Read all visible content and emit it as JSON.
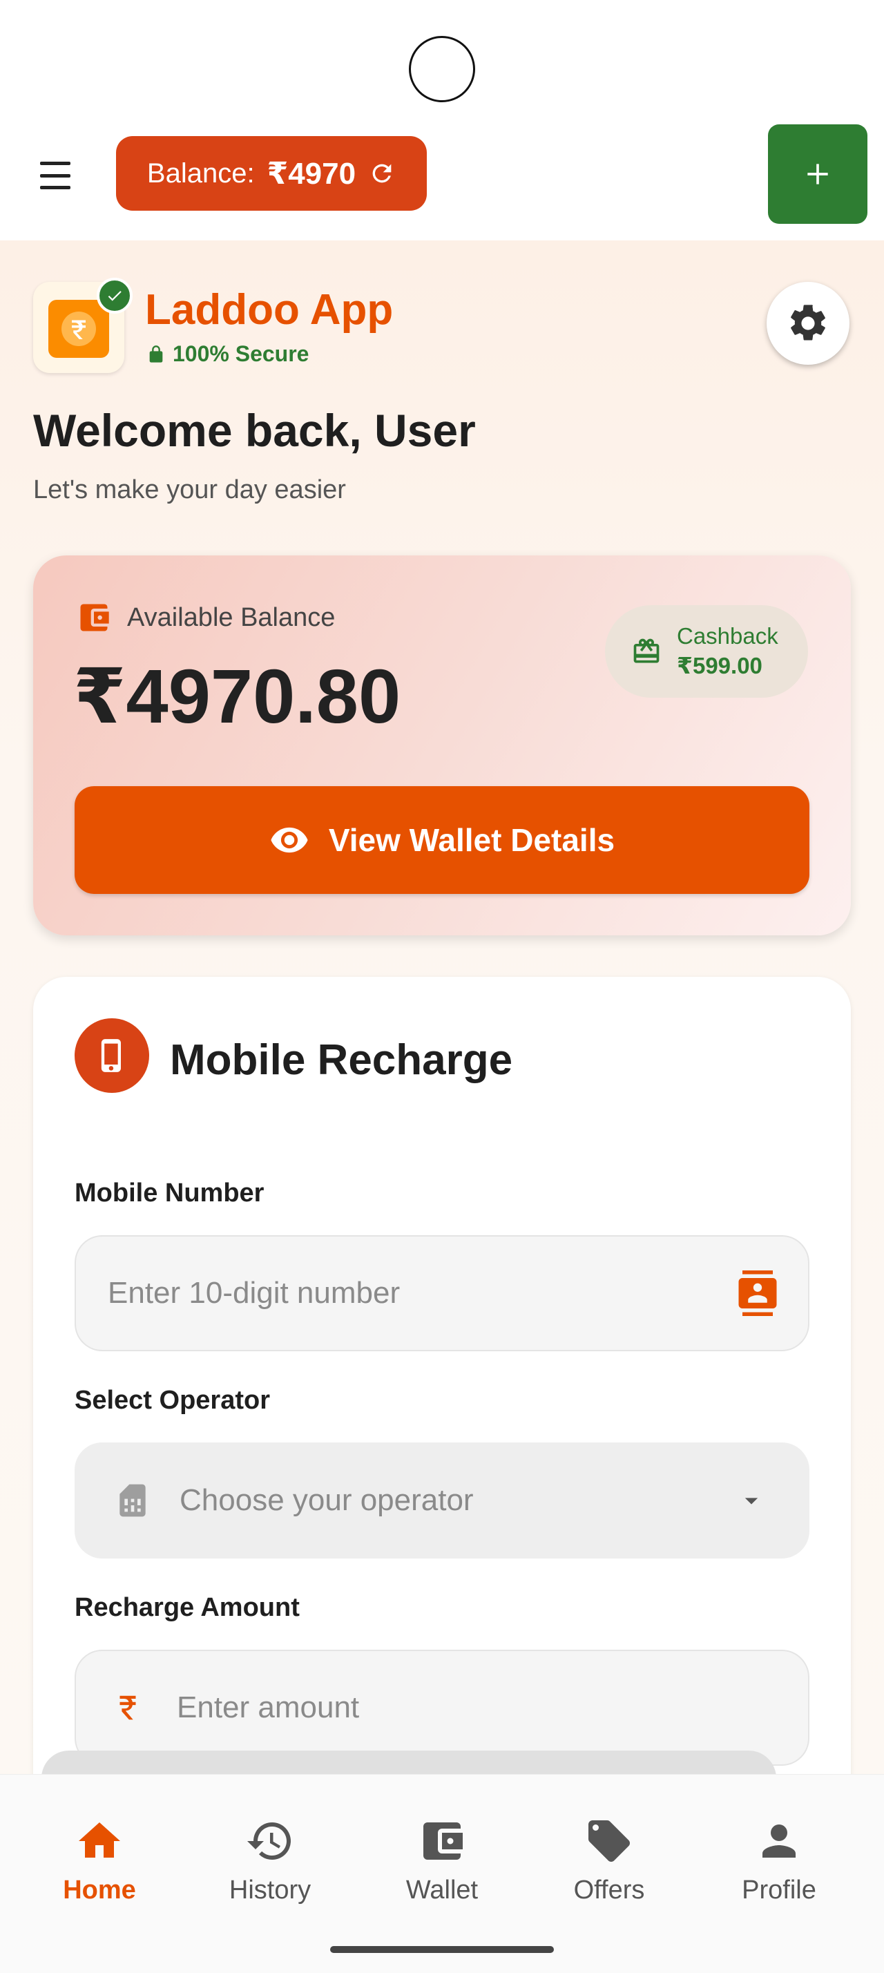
{
  "header": {
    "balance_label": "Balance:",
    "balance_amount": "₹4970"
  },
  "brand": {
    "name": "Laddoo App",
    "secure_text": "100% Secure"
  },
  "welcome": {
    "title": "Welcome back, User",
    "subtitle": "Let's make your day easier"
  },
  "wallet_card": {
    "label": "Available Balance",
    "amount": "₹4970.80",
    "cashback_label": "Cashback",
    "cashback_amount": "₹599.00",
    "button_label": "View Wallet Details"
  },
  "recharge": {
    "title": "Mobile Recharge",
    "mobile_label": "Mobile Number",
    "mobile_placeholder": "Enter 10-digit number",
    "operator_label": "Select Operator",
    "operator_placeholder": "Choose your operator",
    "amount_label": "Recharge Amount",
    "amount_placeholder": "Enter amount"
  },
  "bottom_nav": {
    "items": [
      {
        "label": "Home",
        "icon": "home-icon",
        "active": true
      },
      {
        "label": "History",
        "icon": "history-icon",
        "active": false
      },
      {
        "label": "Wallet",
        "icon": "wallet-icon",
        "active": false
      },
      {
        "label": "Offers",
        "icon": "tag-icon",
        "active": false
      },
      {
        "label": "Profile",
        "icon": "person-icon",
        "active": false
      }
    ]
  },
  "colors": {
    "primary": "#e65100",
    "balance_pill": "#d84315",
    "success": "#2e7d32"
  }
}
